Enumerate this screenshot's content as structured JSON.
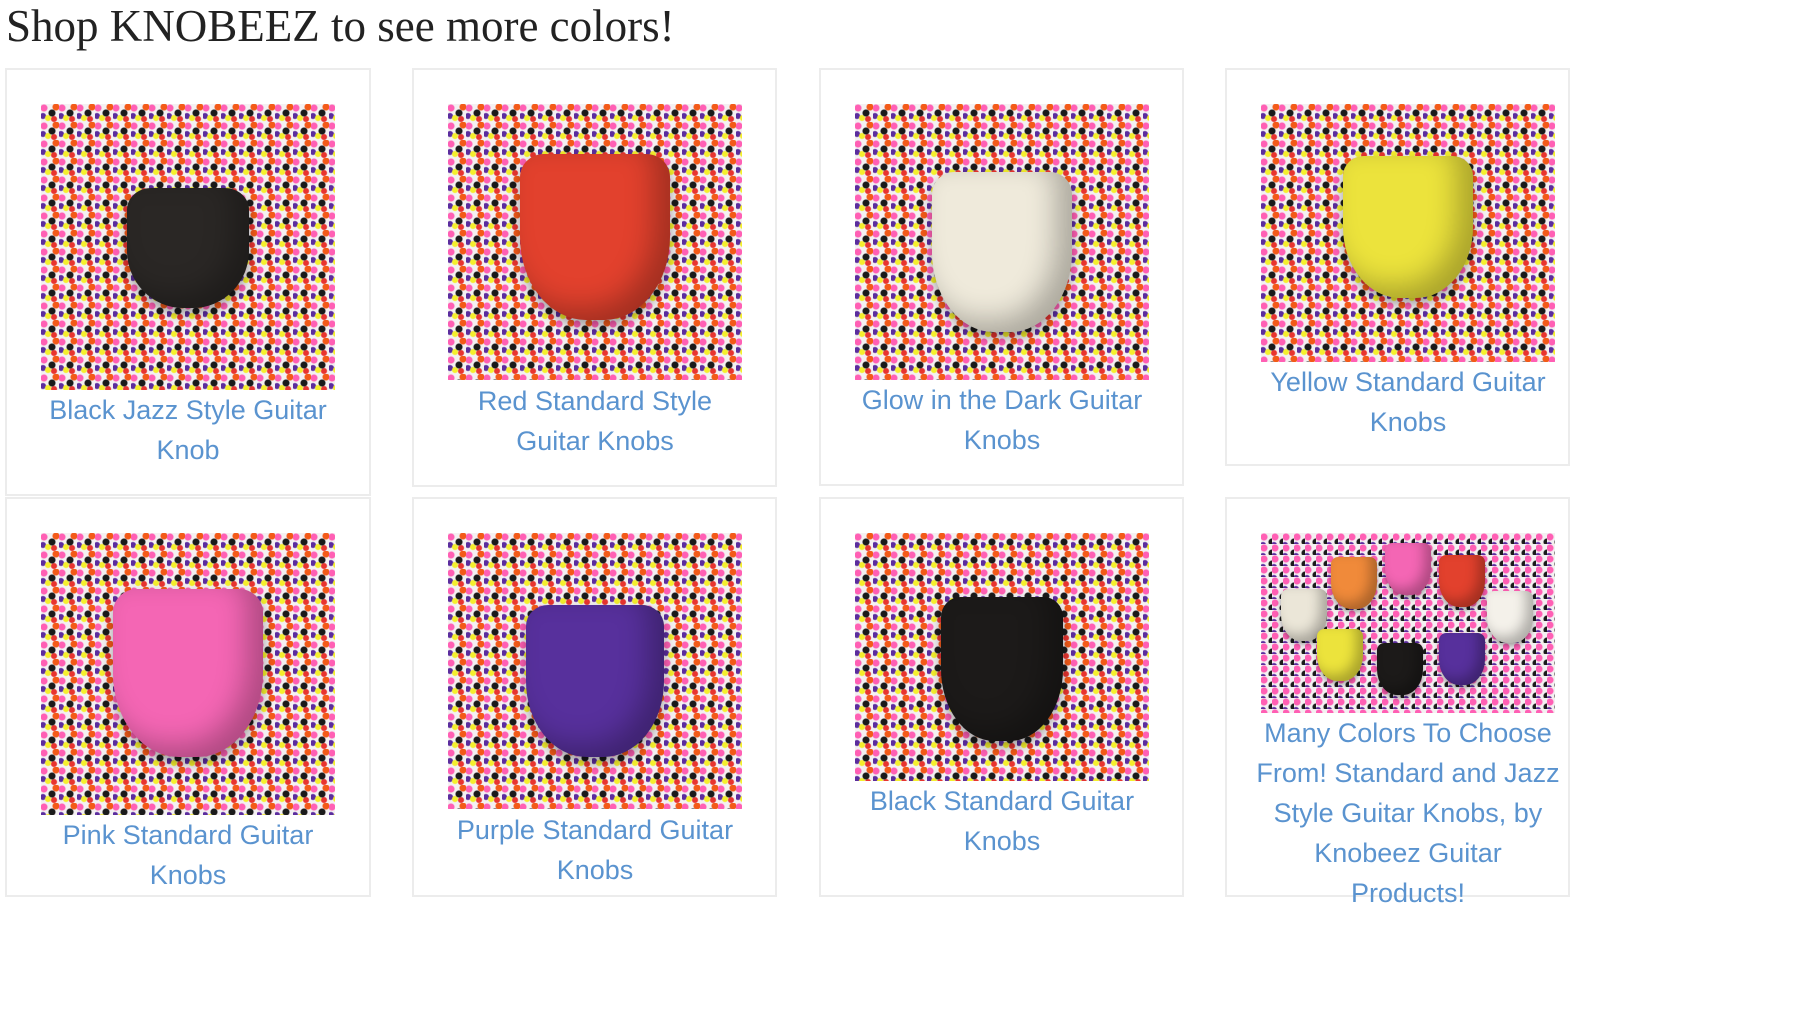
{
  "page": {
    "heading": "Shop KNOBEEZ to see more colors!"
  },
  "products": [
    {
      "caption": "Black Jazz Style Guitar Knob",
      "knob_color": "#2a2725",
      "image_name": "black-jazz-knob-image"
    },
    {
      "caption": "Red Standard Style Guitar Knobs",
      "knob_color": "#e2412d",
      "image_name": "red-standard-knob-image"
    },
    {
      "caption": "Glow in the Dark Guitar Knobs",
      "knob_color": "#efeadb",
      "image_name": "glow-knob-image"
    },
    {
      "caption": "Yellow Standard Guitar Knobs",
      "knob_color": "#ece33c",
      "image_name": "yellow-knob-image"
    },
    {
      "caption": "Pink Standard Guitar Knobs",
      "knob_color": "#f466b4",
      "image_name": "pink-knob-image"
    },
    {
      "caption": "Purple Standard Guitar Knobs",
      "knob_color": "#57309c",
      "image_name": "purple-knob-image"
    },
    {
      "caption": "Black Standard Guitar Knobs",
      "knob_color": "#1c1a19",
      "image_name": "black-standard-knob-image"
    },
    {
      "caption": "Many Colors To Choose From! Standard and Jazz Style Guitar Knobs, by Knobeez Guitar Products!",
      "knob_colors": [
        "#ebe6d8",
        "#f08a3a",
        "#f466b4",
        "#e2412d",
        "#f4f1ea",
        "#ece33c",
        "#1c1a19",
        "#57309c"
      ],
      "image_name": "many-colors-knobs-image"
    }
  ],
  "colors": {
    "link": "#5a93cf",
    "heading": "#222222",
    "card_border": "#ececec"
  }
}
